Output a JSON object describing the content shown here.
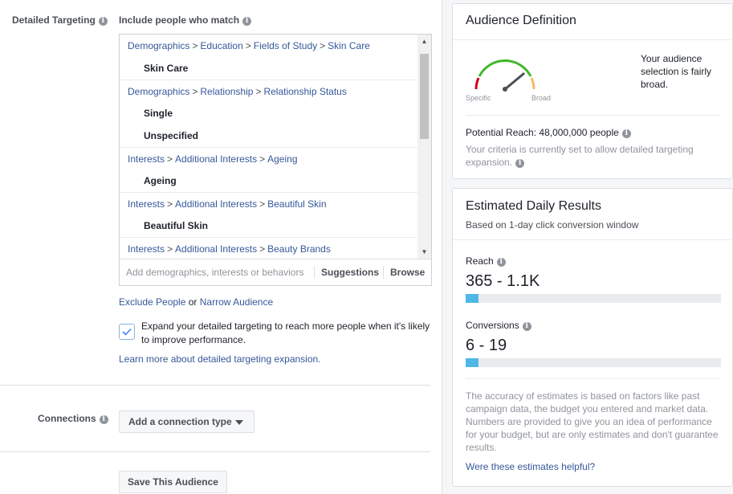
{
  "targeting": {
    "label": "Detailed Targeting",
    "include_label": "Include people who match",
    "groups": [
      {
        "path": [
          "Demographics",
          "Education",
          "Fields of Study",
          "Skin Care"
        ],
        "items": [
          "Skin Care"
        ]
      },
      {
        "path": [
          "Demographics",
          "Relationship",
          "Relationship Status"
        ],
        "items": [
          "Single",
          "Unspecified"
        ]
      },
      {
        "path": [
          "Interests",
          "Additional Interests",
          "Ageing"
        ],
        "items": [
          "Ageing"
        ]
      },
      {
        "path": [
          "Interests",
          "Additional Interests",
          "Beautiful Skin"
        ],
        "items": [
          "Beautiful Skin"
        ]
      },
      {
        "path": [
          "Interests",
          "Additional Interests",
          "Beauty Brands"
        ],
        "items": []
      }
    ],
    "search_placeholder": "Add demographics, interests or behaviors",
    "suggestions_label": "Suggestions",
    "browse_label": "Browse",
    "exclude_label": "Exclude People",
    "or_text": "or",
    "narrow_label": "Narrow Audience",
    "expand_checked": true,
    "expand_text": "Expand your detailed targeting to reach more people when it's likely to improve performance.",
    "learn_more": "Learn more about detailed targeting expansion."
  },
  "connections": {
    "label": "Connections",
    "button_label": "Add a connection type"
  },
  "save_label": "Save This Audience",
  "audience": {
    "title": "Audience Definition",
    "gauge_specific": "Specific",
    "gauge_broad": "Broad",
    "gauge_level": 0.78,
    "description": "Your audience selection is fairly broad.",
    "potential_reach": "Potential Reach: 48,000,000 people",
    "criteria_note": "Your criteria is currently set to allow detailed targeting expansion."
  },
  "estimates": {
    "title": "Estimated Daily Results",
    "subtitle": "Based on 1-day click conversion window",
    "reach_label": "Reach",
    "reach_value": "365 - 1.1K",
    "reach_fill": 0.05,
    "conversions_label": "Conversions",
    "conversions_value": "6 - 19",
    "conversions_fill": 0.05,
    "disclaimer": "The accuracy of estimates is based on factors like past campaign data, the budget you entered and market data. Numbers are provided to give you an idea of performance for your budget, but are only estimates and don't guarantee results.",
    "helpful": "Were these estimates helpful?"
  },
  "colors": {
    "link": "#365899",
    "bar_fill": "#4fb7e6",
    "gauge_green": "#42b72a",
    "gauge_red": "#d0021b",
    "gauge_orange": "#f7ba62"
  }
}
